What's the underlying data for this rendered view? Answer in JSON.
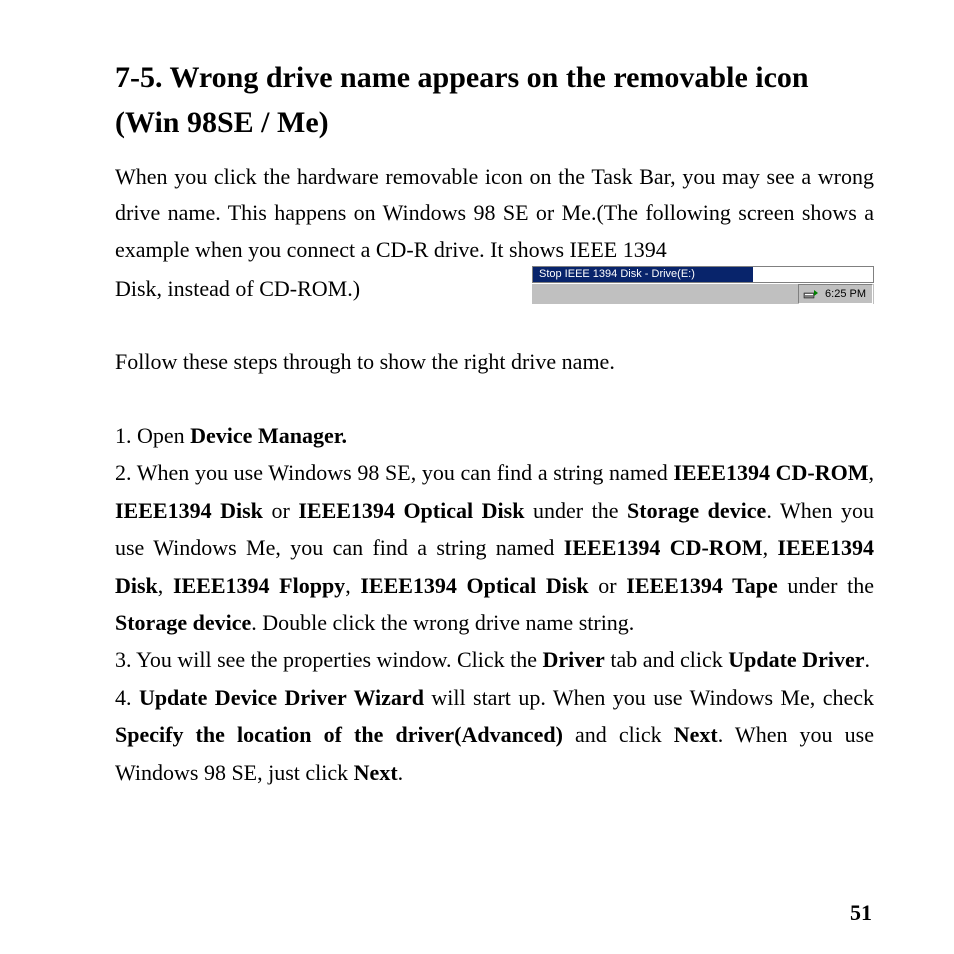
{
  "heading": "7-5. Wrong drive name appears on the removable icon (Win 98SE / Me)",
  "intro_part1": "When you click the hardware removable icon on the Task Bar, you may see a wrong drive name. This happens on Windows 98 SE or Me.(The following screen shows a example when you connect a CD-R drive. It shows IEEE 1394",
  "intro_part2": "Disk, instead of CD-ROM.)",
  "tray_popup_label": "Stop IEEE 1394 Disk - Drive(E:)",
  "tray_clock": "6:25 PM",
  "follow_line": "Follow these steps through to show the right drive name.",
  "step1_prefix": "1. Open ",
  "step1_bold": "Device Manager.",
  "step2_a": "2. When you use Windows 98 SE, you can find a string named ",
  "step2_b1": "IEEE1394 CD-ROM",
  "step2_c": ", ",
  "step2_b2": "IEEE1394 Disk",
  "step2_d": " or ",
  "step2_b3": "IEEE1394 Optical Disk",
  "step2_e": " under the ",
  "step2_b4": "Storage device",
  "step2_f": ". When you use Windows Me, you can find a string named ",
  "step2_b5": "IEEE1394 CD-ROM",
  "step2_g": ", ",
  "step2_b6": "IEEE1394 Disk",
  "step2_h": ", ",
  "step2_b7": "IEEE1394 Floppy",
  "step2_i": ", ",
  "step2_b8": "IEEE1394 Optical Disk",
  "step2_j": " or ",
  "step2_b9": "IEEE1394 Tape",
  "step2_k": " under the ",
  "step2_b10": "Storage device",
  "step2_l": ". Double click the wrong drive name string.",
  "step3_a": "3. You will see the properties window. Click the ",
  "step3_b1": "Driver",
  "step3_b": " tab and click ",
  "step3_b2": "Update Driver",
  "step3_c": ".",
  "step4_a": "4. ",
  "step4_b1": "Update Device Driver Wizard",
  "step4_b": " will start up. When you use Windows Me, check ",
  "step4_b2": "Specify the location of the driver(Advanced)",
  "step4_c": " and click ",
  "step4_b3": "Next",
  "step4_d": ". When you use Windows 98 SE, just click ",
  "step4_b4": "Next",
  "step4_e": ".",
  "page_number": "51"
}
